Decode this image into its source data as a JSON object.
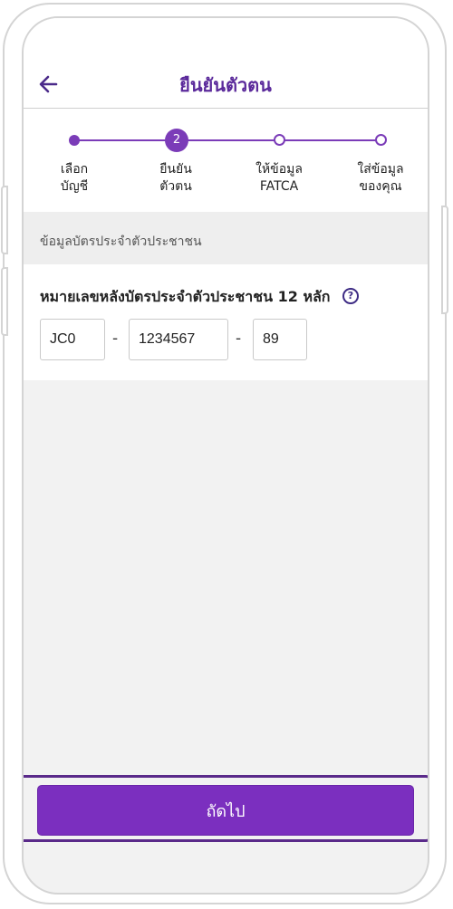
{
  "header": {
    "title": "ยืนยันตัวตน",
    "back_icon": "arrow-left-icon"
  },
  "stepper": {
    "steps": [
      {
        "label": "เลือก\nบัญชี",
        "state": "done"
      },
      {
        "label": "ยืนยัน\nตัวตน",
        "state": "active",
        "number": "2"
      },
      {
        "label": "ให้ข้อมูล\nFATCA",
        "state": "todo"
      },
      {
        "label": "ใส่ข้อมูล\nของคุณ",
        "state": "todo"
      }
    ]
  },
  "section": {
    "title": "ข้อมูลบัตรประจำตัวประชาชน"
  },
  "id_card": {
    "label": "หมายเลขหลังบัตรประจำตัวประชาชน 12 หลัก",
    "help_icon": "question-circle-icon",
    "help_glyph": "?",
    "part1": "JC0",
    "part2": "1234567",
    "part3": "89",
    "separator": "-"
  },
  "footer": {
    "next_label": "ถัดไป"
  },
  "colors": {
    "brand_purple": "#7b2fbf",
    "title_purple": "#5b2a9b",
    "background": "#f2f2f2"
  }
}
